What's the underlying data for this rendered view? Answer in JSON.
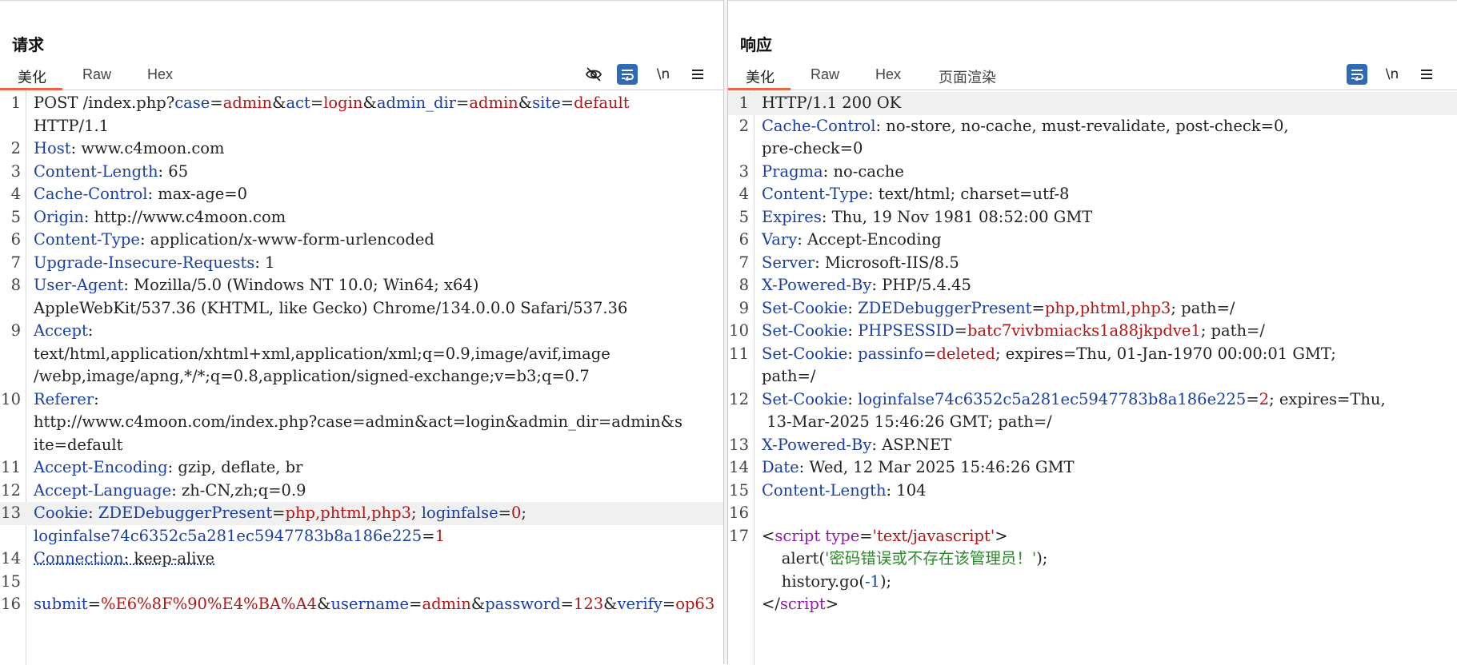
{
  "request": {
    "title": "请求",
    "tabs": [
      "美化",
      "Raw",
      "Hex"
    ],
    "lines": [
      {
        "n": "1",
        "parts": [
          [
            "t",
            "POST /index.php?"
          ],
          [
            "k",
            "case"
          ],
          [
            "t",
            "="
          ],
          [
            "v",
            "admin"
          ],
          [
            "t",
            "&"
          ],
          [
            "k",
            "act"
          ],
          [
            "t",
            "="
          ],
          [
            "v",
            "login"
          ],
          [
            "t",
            "&"
          ],
          [
            "k",
            "admin_dir"
          ],
          [
            "t",
            "="
          ],
          [
            "v",
            "admin"
          ],
          [
            "t",
            "&"
          ],
          [
            "k",
            "site"
          ],
          [
            "t",
            "="
          ],
          [
            "v",
            "default"
          ]
        ]
      },
      {
        "n": "",
        "parts": [
          [
            "t",
            "HTTP/1.1"
          ]
        ]
      },
      {
        "n": "2",
        "parts": [
          [
            "k",
            "Host"
          ],
          [
            "t",
            ": www.c4moon.com"
          ]
        ]
      },
      {
        "n": "3",
        "parts": [
          [
            "k",
            "Content-Length"
          ],
          [
            "t",
            ": 65"
          ]
        ]
      },
      {
        "n": "4",
        "parts": [
          [
            "k",
            "Cache-Control"
          ],
          [
            "t",
            ": max-age=0"
          ]
        ]
      },
      {
        "n": "5",
        "parts": [
          [
            "k",
            "Origin"
          ],
          [
            "t",
            ": http://www.c4moon.com"
          ]
        ]
      },
      {
        "n": "6",
        "parts": [
          [
            "k",
            "Content-Type"
          ],
          [
            "t",
            ": application/x-www-form-urlencoded"
          ]
        ]
      },
      {
        "n": "7",
        "parts": [
          [
            "k",
            "Upgrade-Insecure-Requests"
          ],
          [
            "t",
            ": 1"
          ]
        ]
      },
      {
        "n": "8",
        "parts": [
          [
            "k",
            "User-Agent"
          ],
          [
            "t",
            ": Mozilla/5.0 (Windows NT 10.0; Win64; x64)"
          ]
        ]
      },
      {
        "n": "",
        "parts": [
          [
            "t",
            "AppleWebKit/537.36 (KHTML, like Gecko) Chrome/134.0.0.0 Safari/537.36"
          ]
        ]
      },
      {
        "n": "9",
        "parts": [
          [
            "k",
            "Accept"
          ],
          [
            "t",
            ":"
          ]
        ]
      },
      {
        "n": "",
        "parts": [
          [
            "t",
            "text/html,application/xhtml+xml,application/xml;q=0.9,image/avif,image"
          ]
        ]
      },
      {
        "n": "",
        "parts": [
          [
            "t",
            "/webp,image/apng,*/*;q=0.8,application/signed-exchange;v=b3;q=0.7"
          ]
        ]
      },
      {
        "n": "10",
        "parts": [
          [
            "k",
            "Referer"
          ],
          [
            "t",
            ":"
          ]
        ]
      },
      {
        "n": "",
        "parts": [
          [
            "t",
            "http://www.c4moon.com/index.php?case=admin&act=login&admin_dir=admin&s"
          ]
        ]
      },
      {
        "n": "",
        "parts": [
          [
            "t",
            "ite=default"
          ]
        ]
      },
      {
        "n": "11",
        "parts": [
          [
            "k",
            "Accept-Encoding"
          ],
          [
            "t",
            ": gzip, deflate, br"
          ]
        ]
      },
      {
        "n": "12",
        "parts": [
          [
            "k",
            "Accept-Language"
          ],
          [
            "t",
            ": zh-CN,zh;q=0.9"
          ]
        ]
      },
      {
        "n": "13",
        "hl": true,
        "parts": [
          [
            "k",
            "Cookie"
          ],
          [
            "t",
            ": "
          ],
          [
            "k",
            "ZDEDebuggerPresent"
          ],
          [
            "t",
            "="
          ],
          [
            "v",
            "php,phtml,php3"
          ],
          [
            "t",
            "; "
          ],
          [
            "k",
            "loginfalse"
          ],
          [
            "t",
            "="
          ],
          [
            "v",
            "0"
          ],
          [
            "t",
            ";"
          ]
        ]
      },
      {
        "n": "",
        "parts": [
          [
            "k",
            "loginfalse74c6352c5a281ec5947783b8a186e225"
          ],
          [
            "t",
            "="
          ],
          [
            "v",
            "1"
          ]
        ]
      },
      {
        "n": "14",
        "parts": [
          [
            "ku",
            "Connection"
          ],
          [
            "tu",
            ": keep-alive"
          ]
        ]
      },
      {
        "n": "15",
        "parts": [
          [
            "t",
            ""
          ]
        ]
      },
      {
        "n": "16",
        "parts": [
          [
            "k",
            "submit"
          ],
          [
            "t",
            "="
          ],
          [
            "v",
            "%E6%8F%90%E4%BA%A4"
          ],
          [
            "t",
            "&"
          ],
          [
            "k",
            "username"
          ],
          [
            "t",
            "="
          ],
          [
            "v",
            "admin"
          ],
          [
            "t",
            "&"
          ],
          [
            "k",
            "password"
          ],
          [
            "t",
            "="
          ],
          [
            "v",
            "123"
          ],
          [
            "t",
            "&"
          ],
          [
            "k",
            "verify"
          ],
          [
            "t",
            "="
          ],
          [
            "v",
            "op63"
          ]
        ]
      }
    ]
  },
  "response": {
    "title": "响应",
    "tabs": [
      "美化",
      "Raw",
      "Hex",
      "页面渲染"
    ],
    "lines": [
      {
        "n": "1",
        "hl": true,
        "parts": [
          [
            "t",
            "HTTP/1.1 200 OK"
          ]
        ]
      },
      {
        "n": "2",
        "parts": [
          [
            "k",
            "Cache-Control"
          ],
          [
            "t",
            ": no-store, no-cache, must-revalidate, post-check=0,"
          ]
        ]
      },
      {
        "n": "",
        "parts": [
          [
            "t",
            "pre-check=0"
          ]
        ]
      },
      {
        "n": "3",
        "parts": [
          [
            "k",
            "Pragma"
          ],
          [
            "t",
            ": no-cache"
          ]
        ]
      },
      {
        "n": "4",
        "parts": [
          [
            "k",
            "Content-Type"
          ],
          [
            "t",
            ": text/html; charset=utf-8"
          ]
        ]
      },
      {
        "n": "5",
        "parts": [
          [
            "k",
            "Expires"
          ],
          [
            "t",
            ": Thu, 19 Nov 1981 08:52:00 GMT"
          ]
        ]
      },
      {
        "n": "6",
        "parts": [
          [
            "k",
            "Vary"
          ],
          [
            "t",
            ": Accept-Encoding"
          ]
        ]
      },
      {
        "n": "7",
        "parts": [
          [
            "k",
            "Server"
          ],
          [
            "t",
            ": Microsoft-IIS/8.5"
          ]
        ]
      },
      {
        "n": "8",
        "parts": [
          [
            "k",
            "X-Powered-By"
          ],
          [
            "t",
            ": PHP/5.4.45"
          ]
        ]
      },
      {
        "n": "9",
        "parts": [
          [
            "k",
            "Set-Cookie"
          ],
          [
            "t",
            ": "
          ],
          [
            "k",
            "ZDEDebuggerPresent"
          ],
          [
            "t",
            "="
          ],
          [
            "v",
            "php,phtml,php3"
          ],
          [
            "t",
            "; path=/"
          ]
        ]
      },
      {
        "n": "10",
        "parts": [
          [
            "k",
            "Set-Cookie"
          ],
          [
            "t",
            ": "
          ],
          [
            "k",
            "PHPSESSID"
          ],
          [
            "t",
            "="
          ],
          [
            "v",
            "batc7vivbmiacks1a88jkpdve1"
          ],
          [
            "t",
            "; path=/"
          ]
        ]
      },
      {
        "n": "11",
        "parts": [
          [
            "k",
            "Set-Cookie"
          ],
          [
            "t",
            ": "
          ],
          [
            "k",
            "passinfo"
          ],
          [
            "t",
            "="
          ],
          [
            "v",
            "deleted"
          ],
          [
            "t",
            "; expires=Thu, 01-Jan-1970 00:00:01 GMT;"
          ]
        ]
      },
      {
        "n": "",
        "parts": [
          [
            "t",
            "path=/"
          ]
        ]
      },
      {
        "n": "12",
        "parts": [
          [
            "k",
            "Set-Cookie"
          ],
          [
            "t",
            ": "
          ],
          [
            "k",
            "loginfalse74c6352c5a281ec5947783b8a186e225"
          ],
          [
            "t",
            "="
          ],
          [
            "v",
            "2"
          ],
          [
            "t",
            "; expires=Thu,"
          ]
        ]
      },
      {
        "n": "",
        "parts": [
          [
            "t",
            " 13-Mar-2025 15:46:26 GMT; path=/"
          ]
        ]
      },
      {
        "n": "13",
        "parts": [
          [
            "k",
            "X-Powered-By"
          ],
          [
            "t",
            ": ASP.NET"
          ]
        ]
      },
      {
        "n": "14",
        "parts": [
          [
            "k",
            "Date"
          ],
          [
            "t",
            ": Wed, 12 Mar 2025 15:46:26 GMT"
          ]
        ]
      },
      {
        "n": "15",
        "parts": [
          [
            "k",
            "Content-Length"
          ],
          [
            "t",
            ": 104"
          ]
        ]
      },
      {
        "n": "16",
        "parts": [
          [
            "t",
            ""
          ]
        ]
      },
      {
        "n": "17",
        "parts": [
          [
            "t",
            "<"
          ],
          [
            "g",
            "script"
          ],
          [
            "t",
            " "
          ],
          [
            "g",
            "type"
          ],
          [
            "t",
            "="
          ],
          [
            "v",
            "'text/javascript'"
          ],
          [
            "t",
            ">"
          ]
        ]
      },
      {
        "n": "",
        "parts": [
          [
            "t",
            "    alert("
          ],
          [
            "s",
            "'密码错误或不存在该管理员！'"
          ],
          [
            "t",
            ");"
          ]
        ]
      },
      {
        "n": "",
        "parts": [
          [
            "t",
            "    history.go("
          ],
          [
            "k",
            "-1"
          ],
          [
            "t",
            ");"
          ]
        ]
      },
      {
        "n": "",
        "parts": [
          [
            "t",
            "</"
          ],
          [
            "g",
            "script"
          ],
          [
            "t",
            ">"
          ]
        ]
      }
    ]
  },
  "icons": {
    "hide": "eye-slash-icon",
    "wrap": "wrap-lines-icon",
    "newline": "newline-toggle-icon",
    "menu": "hamburger-menu-icon"
  },
  "newline_label": "\\n",
  "colors": {
    "accent": "#2f6ab5",
    "tab_underline": "#e8663d",
    "key": "#1a3ea8",
    "value": "#b21515"
  }
}
